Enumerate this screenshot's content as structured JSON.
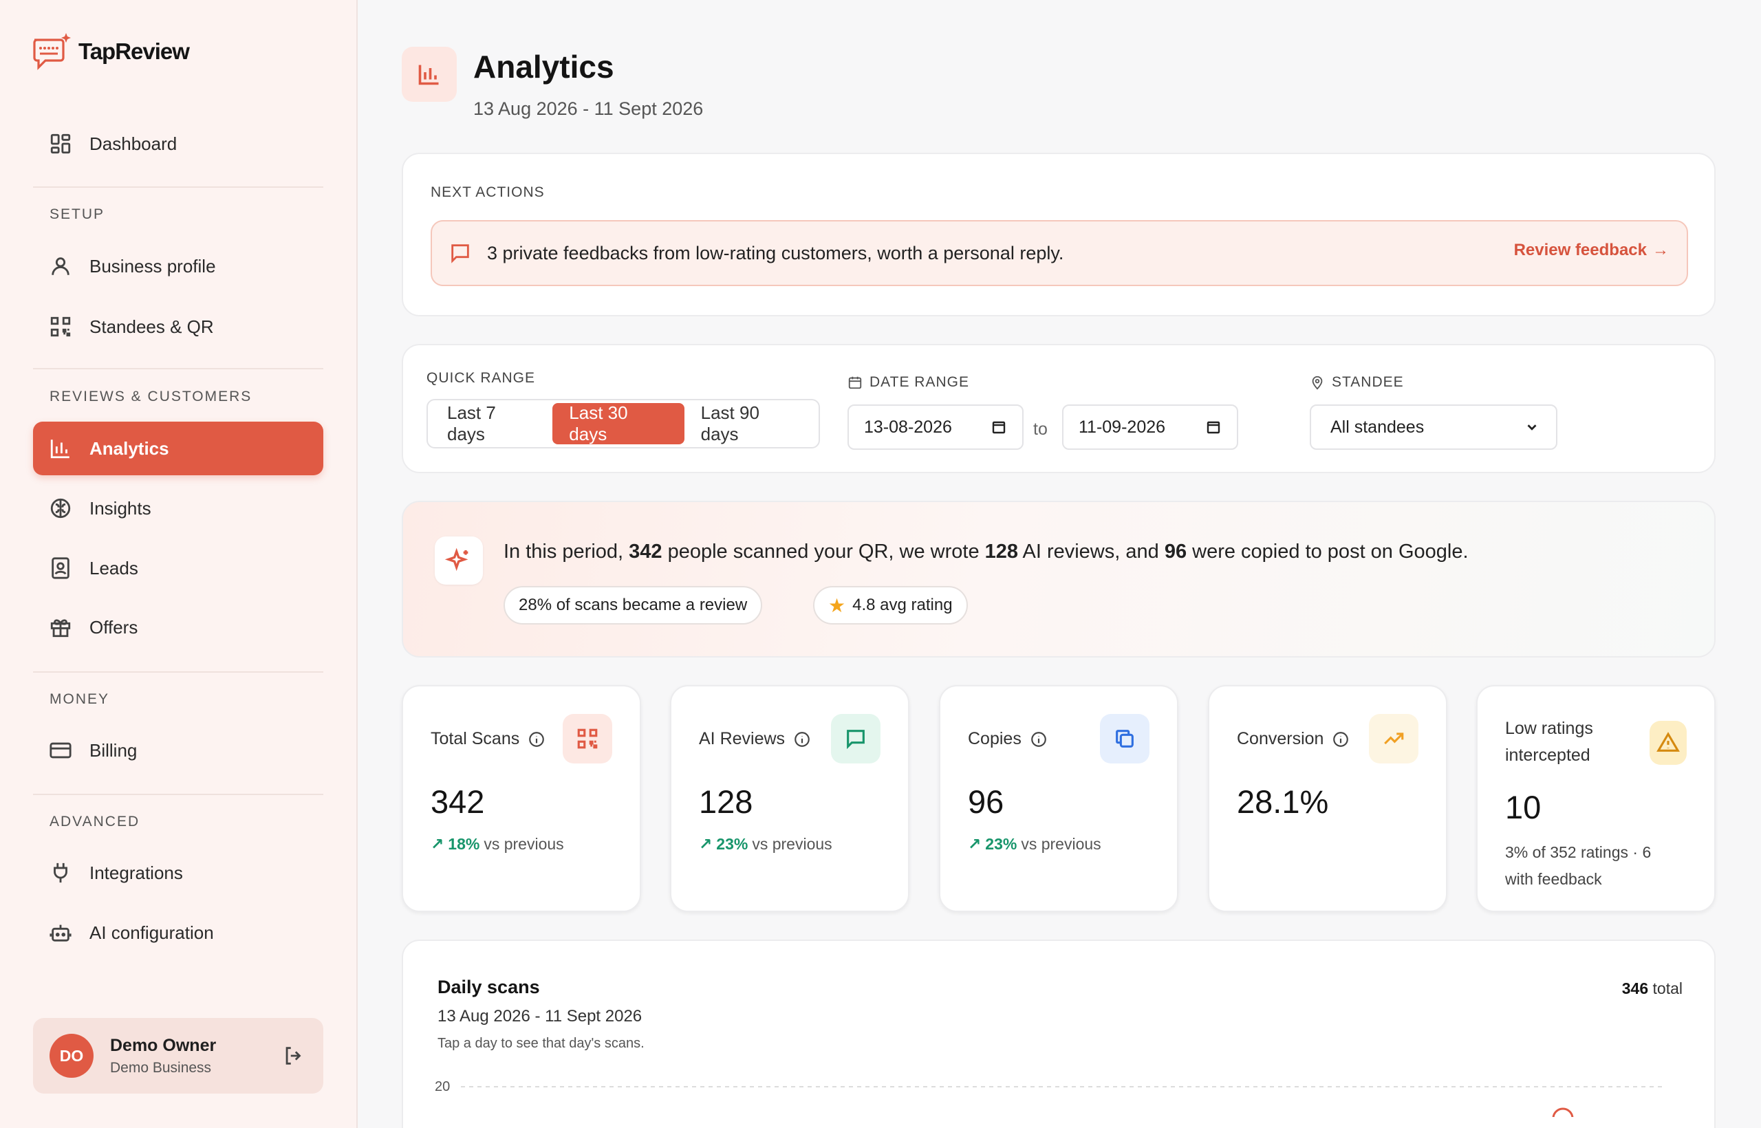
{
  "app": {
    "name": "TapReview"
  },
  "sidebar": {
    "dashboard": "Dashboard",
    "sections": {
      "setup": "SETUP",
      "reviews": "REVIEWS & CUSTOMERS",
      "money": "MONEY",
      "advanced": "ADVANCED"
    },
    "items": {
      "business_profile": "Business profile",
      "standees": "Standees & QR",
      "analytics": "Analytics",
      "insights": "Insights",
      "leads": "Leads",
      "offers": "Offers",
      "billing": "Billing",
      "integrations": "Integrations",
      "ai_config": "AI configuration"
    },
    "user": {
      "initials": "DO",
      "name": "Demo Owner",
      "business": "Demo Business"
    }
  },
  "header": {
    "title": "Analytics",
    "date_range": "13 Aug 2026 - 11 Sept 2026"
  },
  "next_actions": {
    "label": "NEXT ACTIONS",
    "message": "3 private feedbacks from low-rating customers, worth a personal reply.",
    "link": "Review feedback"
  },
  "filters": {
    "quick_range_label": "QUICK RANGE",
    "quick_ranges": [
      "Last 7 days",
      "Last 30 days",
      "Last 90 days"
    ],
    "active_range": "Last 30 days",
    "date_range_label": "DATE RANGE",
    "date_from": "13-08-2026",
    "to_label": "to",
    "date_to": "11-09-2026",
    "standee_label": "STANDEE",
    "standee_value": "All standees"
  },
  "summary": {
    "prefix": "In this period, ",
    "scans": "342",
    "mid1": " people scanned your QR, we wrote ",
    "reviews": "128",
    "mid2": " AI reviews, and ",
    "copies": "96",
    "suffix": " were copied to post on Google.",
    "pill_conversion": "28% of scans became a review",
    "pill_rating": "4.8 avg rating"
  },
  "stats": [
    {
      "label": "Total Scans",
      "value": "342",
      "delta": "18%",
      "delta_suffix": "vs previous",
      "color": "#e05a44",
      "bg": "#fde8e3",
      "icon": "qr-icon"
    },
    {
      "label": "AI Reviews",
      "value": "128",
      "delta": "23%",
      "delta_suffix": "vs previous",
      "color": "#18956b",
      "bg": "#e4f6ee",
      "icon": "message-icon"
    },
    {
      "label": "Copies",
      "value": "96",
      "delta": "23%",
      "delta_suffix": "vs previous",
      "color": "#2f6fe0",
      "bg": "#e6effd",
      "icon": "copy-icon"
    },
    {
      "label": "Conversion",
      "value": "28.1%",
      "color": "#f0a024",
      "bg": "#fdf5e2",
      "icon": "trending-up-icon"
    },
    {
      "label": "Low ratings intercepted",
      "value": "10",
      "note": "3% of 352 ratings · 6 with feedback",
      "color": "#d58a10",
      "bg": "#fdeec4",
      "icon": "warning-icon"
    }
  ],
  "daily_scans": {
    "title": "Daily scans",
    "date_range": "13 Aug 2026 - 11 Sept 2026",
    "hint": "Tap a day to see that day's scans.",
    "total_value": "346",
    "total_label": "total",
    "y_tick": "20"
  }
}
